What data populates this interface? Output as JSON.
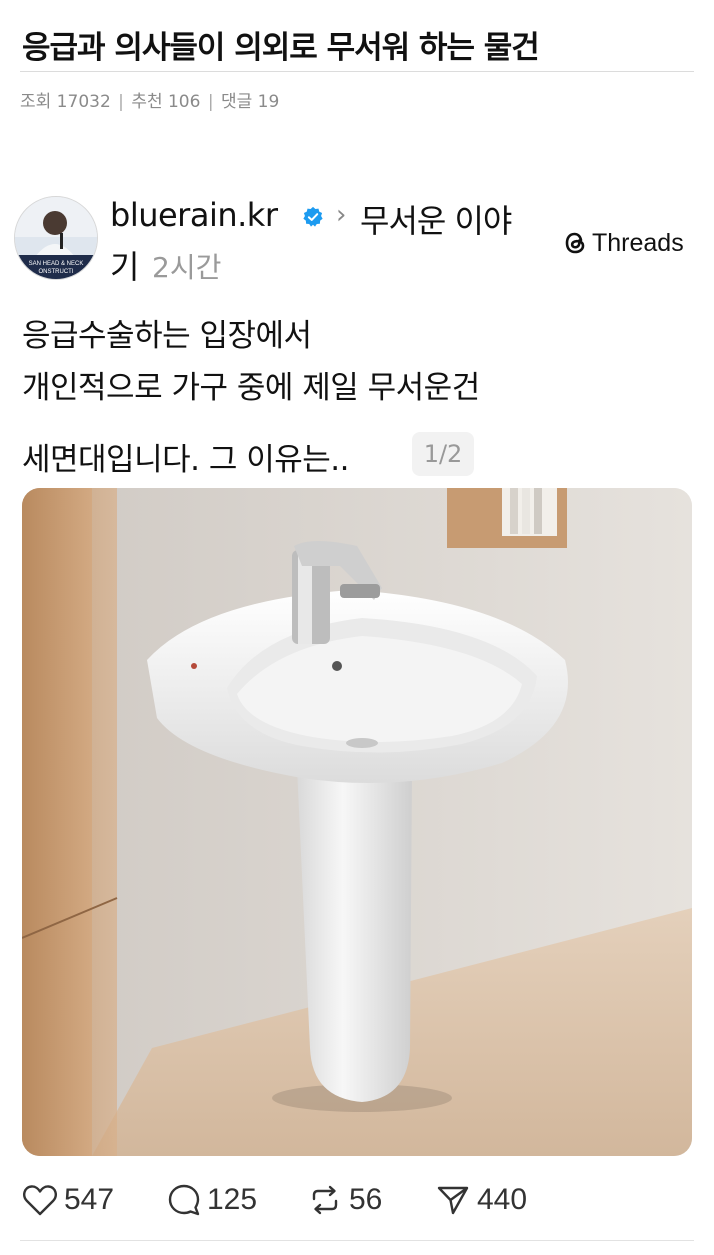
{
  "post": {
    "title": "응급과 의사들이 의외로 무서워 하는 물건",
    "views": "조회 17032",
    "recommends": "추천 106",
    "comments": "댓글 19",
    "separator": "|"
  },
  "threads": {
    "username": "bluerain.kr",
    "community_line1": "무서운 이야",
    "community_line2": "기",
    "time": "2시간",
    "brand": "Threads",
    "avatar_caption_1": "SAN HEAD & NECK",
    "avatar_caption_2": "ONSTRUCTI",
    "text": {
      "line1": "응급수술하는 입장에서",
      "line2": "개인적으로 가구 중에 제일 무서운건",
      "line3": "세면대입니다. 그 이유는.."
    },
    "page_indicator": "1/2",
    "stats": {
      "likes": "547",
      "replies": "125",
      "reposts": "56",
      "shares": "440"
    }
  },
  "colors": {
    "verified": "#1d9bf0",
    "muted": "#8a8a8a",
    "text": "#111111"
  }
}
